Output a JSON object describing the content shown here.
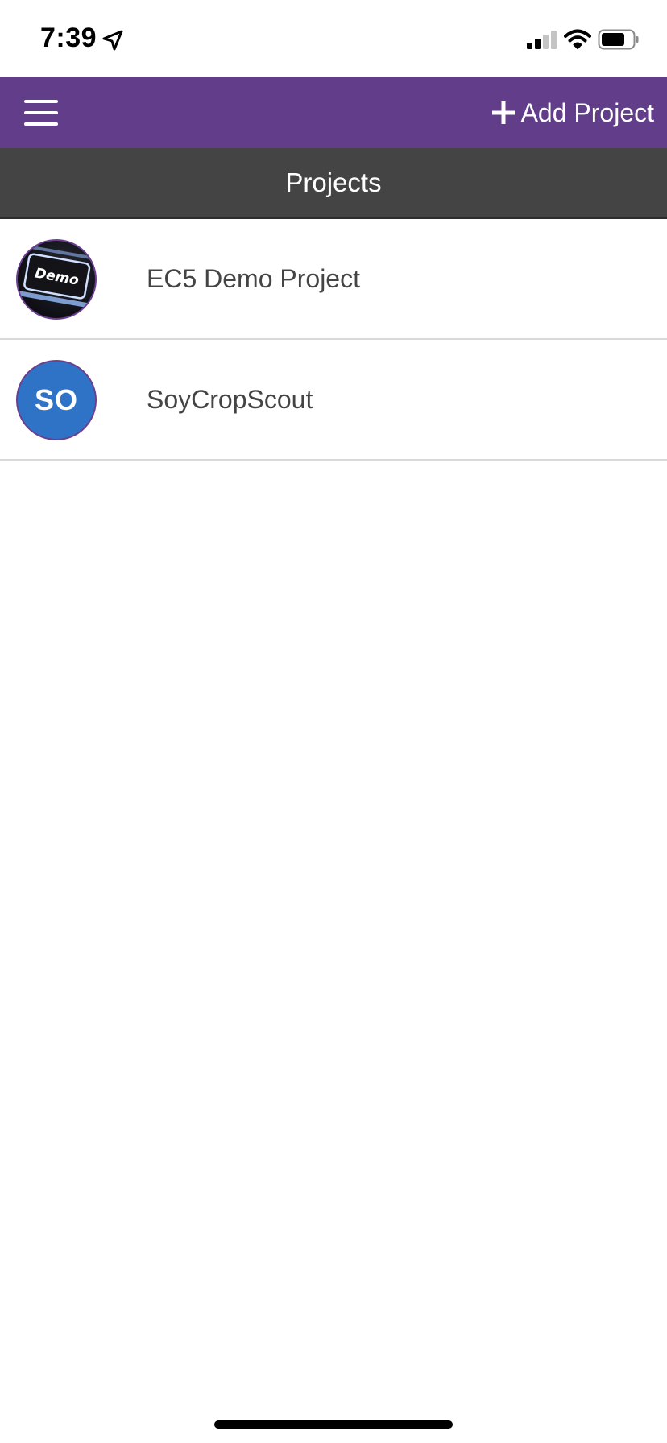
{
  "status_bar": {
    "time": "7:39",
    "icons": [
      "location-arrow-icon",
      "cellular-signal-icon",
      "wifi-icon",
      "battery-icon"
    ]
  },
  "app_bar": {
    "background": "#613d8a",
    "menu_icon": "hamburger-menu-icon",
    "add_icon": "plus-icon",
    "add_label": "Add Project"
  },
  "title_bar": {
    "background": "#444444",
    "title": "Projects"
  },
  "projects": [
    {
      "name": "EC5 Demo Project",
      "avatar": {
        "type": "image",
        "label": "Demo"
      }
    },
    {
      "name": "SoyCropScout",
      "avatar": {
        "type": "initials",
        "initials": "SO",
        "color": "#2f73c7"
      }
    }
  ]
}
